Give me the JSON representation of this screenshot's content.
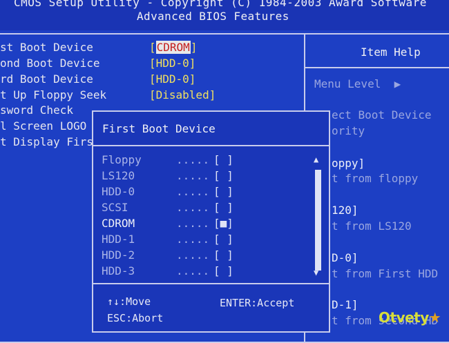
{
  "header": {
    "line1": "CMOS Setup Utility - Copyright (C) 1984-2003 Award Software",
    "line2": "Advanced BIOS Features"
  },
  "settings": [
    {
      "label": "st Boot Device",
      "value_left": "[",
      "value_hl": "CDROM",
      "value_right": "]"
    },
    {
      "label": "ond Boot Device",
      "value": "[HDD-0]"
    },
    {
      "label": "rd Boot Device",
      "value": "[HDD-0]"
    },
    {
      "label": "t Up Floppy Seek",
      "value": "[Disabled]"
    },
    {
      "label": "sword Check"
    },
    {
      "label": "l Screen LOGO"
    },
    {
      "label": "t Display Firs"
    }
  ],
  "help": {
    "title": "Item Help",
    "menu_level": "Menu Level",
    "arrow": "▶",
    "lines": [
      {
        "text": "ect Boot Device",
        "bright": false
      },
      {
        "text": "ority",
        "bright": false
      },
      {
        "text": "oppy]",
        "bright": true
      },
      {
        "text": "t from floppy",
        "bright": false
      },
      {
        "text": "120]",
        "bright": true
      },
      {
        "text": "t from LS120",
        "bright": false
      },
      {
        "text": "D-0]",
        "bright": true
      },
      {
        "text": "t from First HDD",
        "bright": false
      },
      {
        "text": "D-1]",
        "bright": true
      },
      {
        "text": "t from second HD",
        "bright": false
      }
    ]
  },
  "popup": {
    "title": "First Boot Device",
    "options": [
      {
        "name": "Floppy",
        "dots": ".....",
        "box": "[ ]",
        "selected": false
      },
      {
        "name": "LS120",
        "dots": ".....",
        "box": "[ ]",
        "selected": false
      },
      {
        "name": "HDD-0",
        "dots": ".....",
        "box": "[ ]",
        "selected": false
      },
      {
        "name": "SCSI",
        "dots": ".....",
        "box": "[ ]",
        "selected": false
      },
      {
        "name": "CDROM",
        "dots": ".....",
        "box": "[■]",
        "selected": true
      },
      {
        "name": "HDD-1",
        "dots": ".....",
        "box": "[ ]",
        "selected": false
      },
      {
        "name": "HDD-2",
        "dots": ".....",
        "box": "[ ]",
        "selected": false
      },
      {
        "name": "HDD-3",
        "dots": ".....",
        "box": "[ ]",
        "selected": false
      }
    ],
    "scroll_up": "▲",
    "scroll_down": "▼",
    "footer": {
      "move": "↑↓:Move",
      "accept": "ENTER:Accept",
      "abort": "ESC:Abort"
    }
  },
  "watermark": {
    "text": "Otvety",
    "star": "★"
  }
}
